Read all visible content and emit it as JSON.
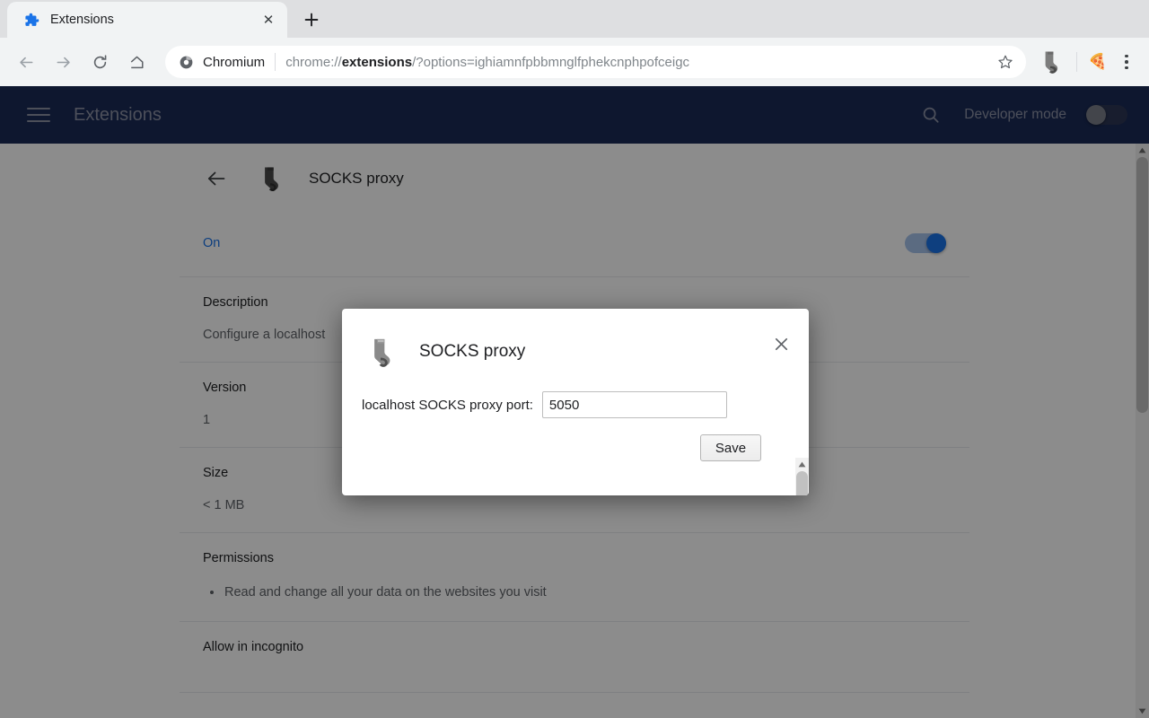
{
  "browser": {
    "tab": {
      "title": "Extensions",
      "favicon": "puzzle-piece-icon",
      "close_label": "✕"
    },
    "new_tab_label": "+",
    "nav": {
      "back": "back-arrow-icon",
      "forward": "forward-arrow-icon",
      "reload": "reload-icon",
      "home": "home-icon"
    },
    "omnibox": {
      "brand": "Chromium",
      "url_prefix": "chrome://",
      "url_bold": "extensions",
      "url_suffix": "/?options=ighiamnfpbbmnglfphekcnphpofceigc",
      "full_url": "chrome://extensions/?options=ighiamnfpbbmnglfphekcnphpofceigc",
      "security_icon": "chromium-logo-icon",
      "star_icon": "bookmark-star-icon"
    },
    "toolbar_icons": {
      "extension": "sock-icon",
      "profile_avatar": "🍕",
      "menu": "three-dot-menu-icon"
    }
  },
  "extensions_page": {
    "header": {
      "menu_icon": "hamburger-menu-icon",
      "title": "Extensions",
      "search_icon": "search-icon",
      "developer_mode_label": "Developer mode",
      "developer_mode_on": false
    },
    "detail": {
      "back_icon": "back-arrow-icon",
      "icon": "sock-icon",
      "title": "SOCKS proxy",
      "enabled_label": "On",
      "enabled": true,
      "sections": [
        {
          "label": "Description",
          "value": "Configure a localhost"
        },
        {
          "label": "Version",
          "value": "1"
        },
        {
          "label": "Size",
          "value": "< 1 MB"
        }
      ],
      "permissions_label": "Permissions",
      "permissions": [
        "Read and change all your data on the websites you visit"
      ],
      "incognito_label": "Allow in incognito"
    }
  },
  "modal": {
    "icon": "sock-icon",
    "title": "SOCKS proxy",
    "close_label": "✕",
    "field_label": "localhost SOCKS proxy port:",
    "field_value": "5050",
    "field_placeholder": "",
    "save_label": "Save"
  },
  "colors": {
    "header_blue": "#1a2a56",
    "accent_blue": "#1a73e8",
    "toolbar_gray": "#f1f3f4",
    "tabstrip_gray": "#dedfe1"
  }
}
